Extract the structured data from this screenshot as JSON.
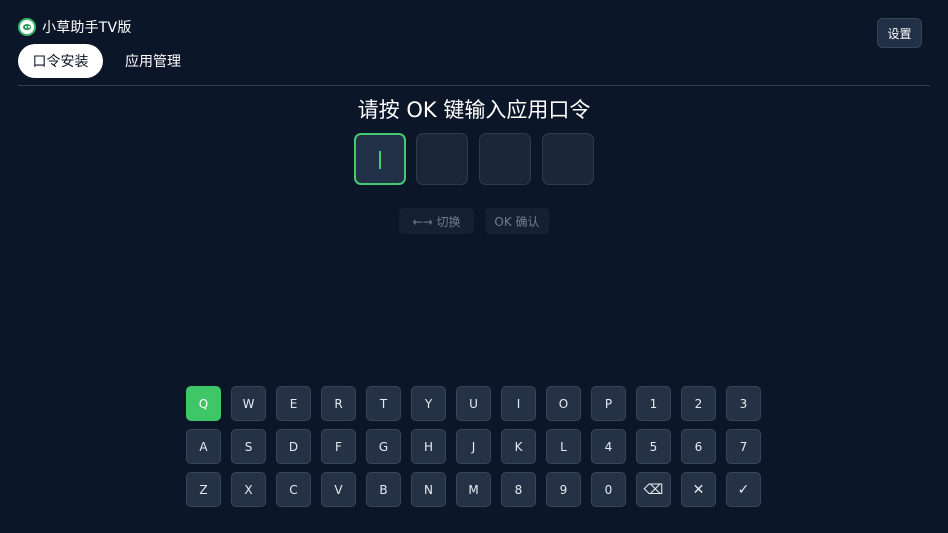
{
  "app": {
    "title": "小草助手TV版",
    "logo_icon": "grass-logo-icon"
  },
  "header": {
    "settings_label": "设置"
  },
  "tabs": [
    {
      "label": "口令安装",
      "active": true
    },
    {
      "label": "应用管理",
      "active": false
    }
  ],
  "main": {
    "prompt": "请按 OK 键输入应用口令",
    "code_boxes": [
      {
        "value": "",
        "focused": true
      },
      {
        "value": "",
        "focused": false
      },
      {
        "value": "",
        "focused": false
      },
      {
        "value": "",
        "focused": false
      }
    ],
    "hints": {
      "switch": "←→ 切换",
      "confirm": "OK 确认"
    }
  },
  "keyboard": {
    "rows": [
      [
        "Q",
        "W",
        "E",
        "R",
        "T",
        "Y",
        "U",
        "I",
        "O",
        "P",
        "1",
        "2",
        "3"
      ],
      [
        "A",
        "S",
        "D",
        "F",
        "G",
        "H",
        "J",
        "K",
        "L",
        "4",
        "5",
        "6",
        "7"
      ],
      [
        "Z",
        "X",
        "C",
        "V",
        "B",
        "N",
        "M",
        "8",
        "9",
        "0",
        "⌫",
        "✕",
        "✓"
      ]
    ],
    "selected_key": "Q",
    "special_keys": {
      "⌫": "backspace-icon",
      "✕": "clear-icon",
      "✓": "confirm-check-icon"
    }
  },
  "colors": {
    "background": "#0b1628",
    "accent": "#3ec667",
    "key": "#253145"
  }
}
